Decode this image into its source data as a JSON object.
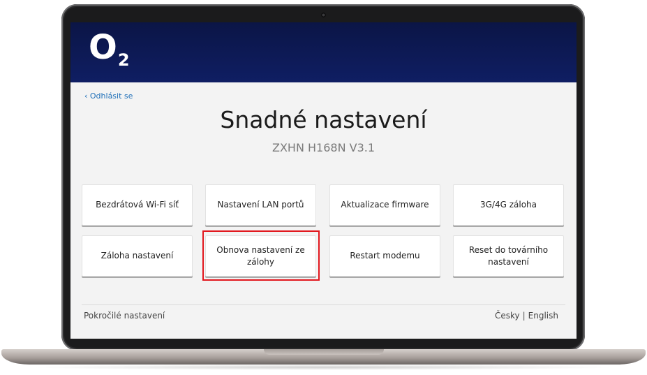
{
  "header": {
    "logo_text": "O",
    "logo_sub": "2"
  },
  "nav": {
    "logout_label": "‹ Odhlásit se"
  },
  "page": {
    "title": "Snadné nastavení",
    "subtitle": "ZXHN H168N V3.1"
  },
  "tiles": [
    {
      "label": "Bezdrátová Wi-Fi síť"
    },
    {
      "label": "Nastavení LAN portů"
    },
    {
      "label": "Aktualizace firmware"
    },
    {
      "label": "3G/4G záloha"
    },
    {
      "label": "Záloha nastavení"
    },
    {
      "label": "Obnova nastavení ze zálohy"
    },
    {
      "label": "Restart modemu"
    },
    {
      "label": "Reset do továrního nastavení"
    }
  ],
  "footer": {
    "advanced_label": "Pokročilé nastavení",
    "lang_cz": "Česky",
    "lang_sep": "|",
    "lang_en": "English"
  },
  "colors": {
    "header_bg": "#0f1e63",
    "link": "#1e6fb8",
    "highlight": "#e2171d"
  }
}
